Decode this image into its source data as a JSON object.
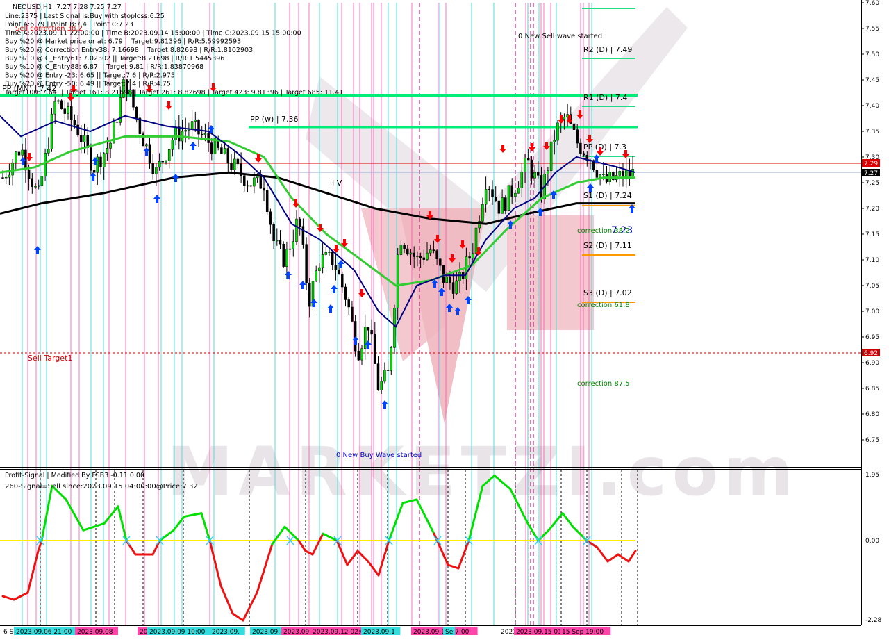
{
  "symbol": "NEOUSD,H1",
  "ohlc": "7.27 7.28 7.25 7.27",
  "info_lines": [
    "Line:2375 | Last Signal is:Buy with stoploss:6.25",
    "Point A:6.79 | Point B:7.4 | Point C:7.23",
    "Time A:2023.09.11 22:00:00 | Time B:2023.09.14 15:00:00 | Time C:2023.09.15 15:00:00",
    "Buy %20 @ Market price or at: 6.79 || Target:9.81396 | R/R:5.59992593",
    "Buy %20 @ Correction Entry38: 7.16698 || Target:8.82698 | R/R:1.8102903",
    "Buy %10 @ C_Entry61: 7.02302 || Target:8.21698 | R/R:1.5445396",
    "Buy %10 @ C_Entry88: 6.87 || Target:9.81 | R/R:1.83870968",
    "Buy %20 @ Entry -23: 6.65 || Target:7.6 | R/R:2.975",
    "Buy %20 @ Entry -50: 6.49 || Target:7.4 | R/R:4.75",
    "Target100: 7.64 || Target 161: 8.21698 | Target 261: 8.82698 | Target 423: 9.81396 | Target 685: 11.41"
  ],
  "labels": {
    "sell_correction": "Sell correction 38.2",
    "new_sell_wave": "0 New Sell wave started",
    "new_buy_wave": "0 New Buy Wave started",
    "sell_target": "Sell Target1",
    "pp_mn": "PP (MN) | 7.42",
    "pp_w": "PP (w) | 7.36",
    "r2_d": "R2 (D) | 7.49",
    "r1_d": "R1 (D) | 7.4",
    "pp_d": "PP (D) | 7.3",
    "s1_d": "S1 (D) | 7.24",
    "s2_d": "S2 (D) | 7.11",
    "s3_d": "S3 (D) | 7.02",
    "corr_382": "correction 38.2",
    "corr_382_val": "7.23",
    "corr_618": "correction 61.8",
    "corr_875": "correction 87.5",
    "wave_label": "I V",
    "watermark": "MARKETZI.com"
  },
  "price_tags": {
    "red": "7.29",
    "current": "7.27",
    "sell_target": "6.92"
  },
  "indicator": {
    "title": "Profit-Signal | Modified By FSB3 -0.11 0.00",
    "subtitle": "260-Signal=Sell since:2023.09.15 04:00:00@Price:7.32"
  },
  "colors": {
    "bull_line": "#00e000",
    "ma_green": "#33cc33",
    "ma_blue": "#000080",
    "ma_black": "#000000",
    "pivot_green": "#00ee77",
    "red_line": "#dd0000",
    "magenta": "#ff44aa",
    "cyan": "#33dddd",
    "buy_arrow": "#0044ff",
    "sell_arrow": "#ff0000"
  },
  "chart_data": {
    "type": "candlestick",
    "price_axis": [
      "7.60",
      "7.55",
      "7.50",
      "7.45",
      "7.40",
      "7.35",
      "7.30",
      "7.25",
      "7.20",
      "7.15",
      "7.10",
      "7.05",
      "7.00",
      "6.95",
      "6.90",
      "6.85",
      "6.80",
      "6.75"
    ],
    "ind_axis": [
      "1.95",
      "0.00",
      "-2.28"
    ],
    "time_labels": [
      "6 Se",
      "2023.09.06 21:00",
      "2023.09.08",
      "2023.09.08 ",
      "2023.09.09 10:00",
      "2023.09.",
      "2023.09.1",
      "2023.09.11 08:0",
      "2023.09.12 02:0",
      "2023.09.1",
      "2023.09.13 07:00",
      "Se",
      "2023.09.14",
      "2023.09.15 01:00",
      "15 Sep 19:00"
    ],
    "ylim": [
      6.69,
      7.605
    ]
  }
}
